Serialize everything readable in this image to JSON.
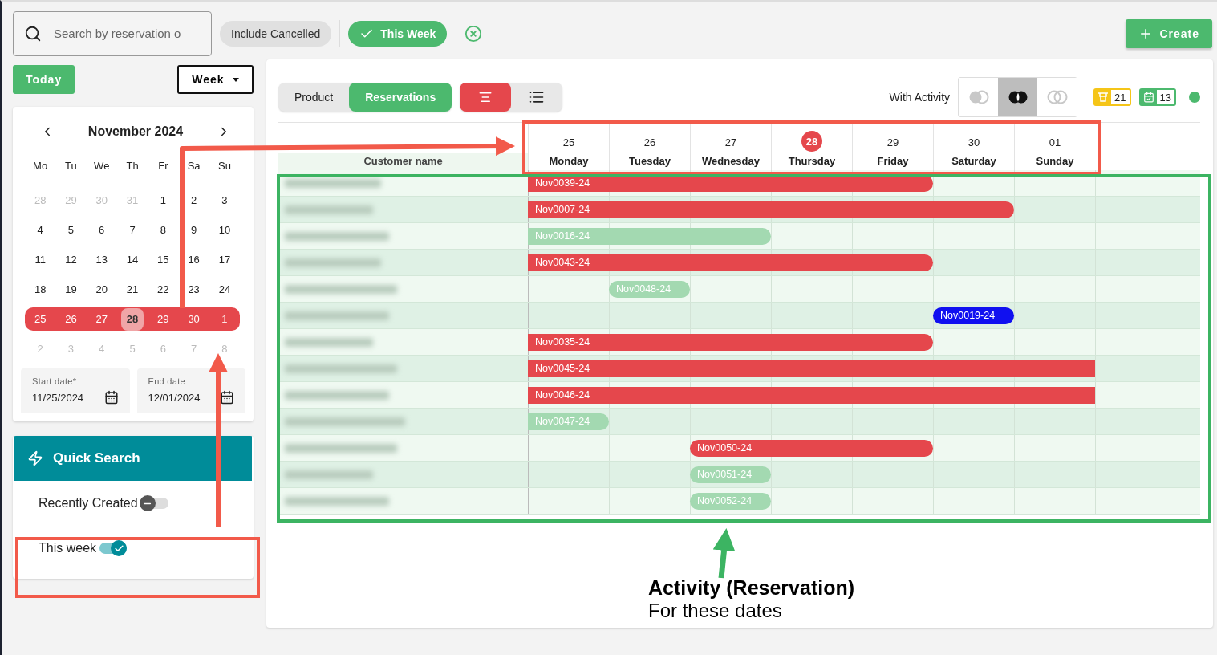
{
  "toolbar": {
    "search": {
      "placeholder": "Search by reservation o"
    },
    "chips": [
      {
        "label": "Include Cancelled",
        "selected": false
      },
      {
        "label": "This Week",
        "selected": true
      }
    ],
    "create_button": "Create"
  },
  "sidebar": {
    "today_button": "Today",
    "view_select": "Week",
    "calendar": {
      "month": "November 2024",
      "weekdays": [
        "Mo",
        "Tu",
        "We",
        "Th",
        "Fr",
        "Sa",
        "Su"
      ],
      "weeks": [
        {
          "selected": false,
          "days": [
            {
              "label": "28",
              "outside": true,
              "today": false
            },
            {
              "label": "29",
              "outside": true,
              "today": false
            },
            {
              "label": "30",
              "outside": true,
              "today": false
            },
            {
              "label": "31",
              "outside": true,
              "today": false
            },
            {
              "label": "1",
              "outside": false,
              "today": false
            },
            {
              "label": "2",
              "outside": false,
              "today": false
            },
            {
              "label": "3",
              "outside": false,
              "today": false
            }
          ]
        },
        {
          "selected": false,
          "days": [
            {
              "label": "4",
              "outside": false,
              "today": false
            },
            {
              "label": "5",
              "outside": false,
              "today": false
            },
            {
              "label": "6",
              "outside": false,
              "today": false
            },
            {
              "label": "7",
              "outside": false,
              "today": false
            },
            {
              "label": "8",
              "outside": false,
              "today": false
            },
            {
              "label": "9",
              "outside": false,
              "today": false
            },
            {
              "label": "10",
              "outside": false,
              "today": false
            }
          ]
        },
        {
          "selected": false,
          "days": [
            {
              "label": "11",
              "outside": false,
              "today": false
            },
            {
              "label": "12",
              "outside": false,
              "today": false
            },
            {
              "label": "13",
              "outside": false,
              "today": false
            },
            {
              "label": "14",
              "outside": false,
              "today": false
            },
            {
              "label": "15",
              "outside": false,
              "today": false
            },
            {
              "label": "16",
              "outside": false,
              "today": false
            },
            {
              "label": "17",
              "outside": false,
              "today": false
            }
          ]
        },
        {
          "selected": false,
          "days": [
            {
              "label": "18",
              "outside": false,
              "today": false
            },
            {
              "label": "19",
              "outside": false,
              "today": false
            },
            {
              "label": "20",
              "outside": false,
              "today": false
            },
            {
              "label": "21",
              "outside": false,
              "today": false
            },
            {
              "label": "22",
              "outside": false,
              "today": false
            },
            {
              "label": "23",
              "outside": false,
              "today": false
            },
            {
              "label": "24",
              "outside": false,
              "today": false
            }
          ]
        },
        {
          "selected": true,
          "days": [
            {
              "label": "25",
              "outside": false,
              "today": false
            },
            {
              "label": "26",
              "outside": false,
              "today": false
            },
            {
              "label": "27",
              "outside": false,
              "today": false
            },
            {
              "label": "28",
              "outside": false,
              "today": true
            },
            {
              "label": "29",
              "outside": false,
              "today": false
            },
            {
              "label": "30",
              "outside": false,
              "today": false
            },
            {
              "label": "1",
              "outside": true,
              "today": false
            }
          ]
        },
        {
          "selected": false,
          "days": [
            {
              "label": "2",
              "outside": true,
              "today": false
            },
            {
              "label": "3",
              "outside": true,
              "today": false
            },
            {
              "label": "4",
              "outside": true,
              "today": false
            },
            {
              "label": "5",
              "outside": true,
              "today": false
            },
            {
              "label": "6",
              "outside": true,
              "today": false
            },
            {
              "label": "7",
              "outside": true,
              "today": false
            },
            {
              "label": "8",
              "outside": true,
              "today": false
            }
          ]
        }
      ]
    },
    "start_date": {
      "label": "Start date*",
      "value": "11/25/2024"
    },
    "end_date": {
      "label": "End date",
      "value": "12/01/2024"
    },
    "quick_search": {
      "title": "Quick Search",
      "toggles": [
        {
          "label": "Recently Created",
          "on": false
        },
        {
          "label": "This week",
          "on": true
        }
      ]
    }
  },
  "main": {
    "view_tabs": [
      {
        "label": "Product",
        "selected": false
      },
      {
        "label": "Reservations",
        "selected": true
      }
    ],
    "layout_buttons": [
      {
        "kind": "timeline",
        "selected": true
      },
      {
        "kind": "list",
        "selected": false
      }
    ],
    "activity_label": "With Activity",
    "activity_filter": [
      {
        "kind": "left",
        "selected": false
      },
      {
        "kind": "inner",
        "selected": true
      },
      {
        "kind": "outer",
        "selected": false
      }
    ],
    "counters": [
      {
        "kind": "pickup",
        "count": "21",
        "color": "#f5c518"
      },
      {
        "kind": "calendar",
        "count": "13",
        "color": "#4cb96e"
      }
    ],
    "status_dot": {
      "color": "#4cb96e"
    },
    "table": {
      "column_header": "Customer name",
      "days": [
        {
          "number": "25",
          "name": "Monday",
          "today": false
        },
        {
          "number": "26",
          "name": "Tuesday",
          "today": false
        },
        {
          "number": "27",
          "name": "Wednesday",
          "today": false
        },
        {
          "number": "28",
          "name": "Thursday",
          "today": true
        },
        {
          "number": "29",
          "name": "Friday",
          "today": false
        },
        {
          "number": "30",
          "name": "Saturday",
          "today": false
        },
        {
          "number": "01",
          "name": "Sunday",
          "today": false
        }
      ],
      "rows": [
        {
          "bar": {
            "label": "Nov0039-24",
            "color": "#e5474c",
            "days": [
              true,
              true,
              true,
              true,
              true,
              false,
              false
            ]
          }
        },
        {
          "bar": {
            "label": "Nov0007-24",
            "color": "#e5474c",
            "days": [
              true,
              true,
              true,
              true,
              true,
              true,
              false
            ]
          }
        },
        {
          "bar": {
            "label": "Nov0016-24",
            "color": "#a3d9b1",
            "days": [
              true,
              true,
              true,
              false,
              false,
              false,
              false
            ]
          }
        },
        {
          "bar": {
            "label": "Nov0043-24",
            "color": "#e5474c",
            "days": [
              true,
              true,
              true,
              true,
              true,
              false,
              false
            ]
          }
        },
        {
          "bar": {
            "label": "Nov0048-24",
            "color": "#a3d9b1",
            "days": [
              false,
              true,
              false,
              false,
              false,
              false,
              false
            ]
          }
        },
        {
          "bar": {
            "label": "Nov0019-24",
            "color": "#1010f0",
            "days": [
              false,
              false,
              false,
              false,
              false,
              true,
              false
            ]
          }
        },
        {
          "bar": {
            "label": "Nov0035-24",
            "color": "#e5474c",
            "days": [
              true,
              true,
              true,
              true,
              true,
              false,
              false
            ]
          }
        },
        {
          "bar": {
            "label": "Nov0045-24",
            "color": "#e5474c",
            "days": [
              true,
              true,
              true,
              true,
              true,
              true,
              true
            ]
          }
        },
        {
          "bar": {
            "label": "Nov0046-24",
            "color": "#e5474c",
            "days": [
              true,
              true,
              true,
              true,
              true,
              true,
              true
            ]
          }
        },
        {
          "bar": {
            "label": "Nov0047-24",
            "color": "#a3d9b1",
            "days": [
              true,
              false,
              false,
              false,
              false,
              false,
              false
            ]
          }
        },
        {
          "bar": {
            "label": "Nov0050-24",
            "color": "#e5474c",
            "days": [
              false,
              false,
              true,
              true,
              true,
              false,
              false
            ]
          }
        },
        {
          "bar": {
            "label": "Nov0051-24",
            "color": "#a3d9b1",
            "days": [
              false,
              false,
              true,
              false,
              false,
              false,
              false
            ]
          }
        },
        {
          "bar": {
            "label": "Nov0052-24",
            "color": "#a3d9b1",
            "days": [
              false,
              false,
              true,
              false,
              false,
              false,
              false
            ]
          }
        }
      ]
    }
  },
  "annotation": {
    "title": "Activity (Reservation)",
    "subtitle": "For these dates"
  }
}
